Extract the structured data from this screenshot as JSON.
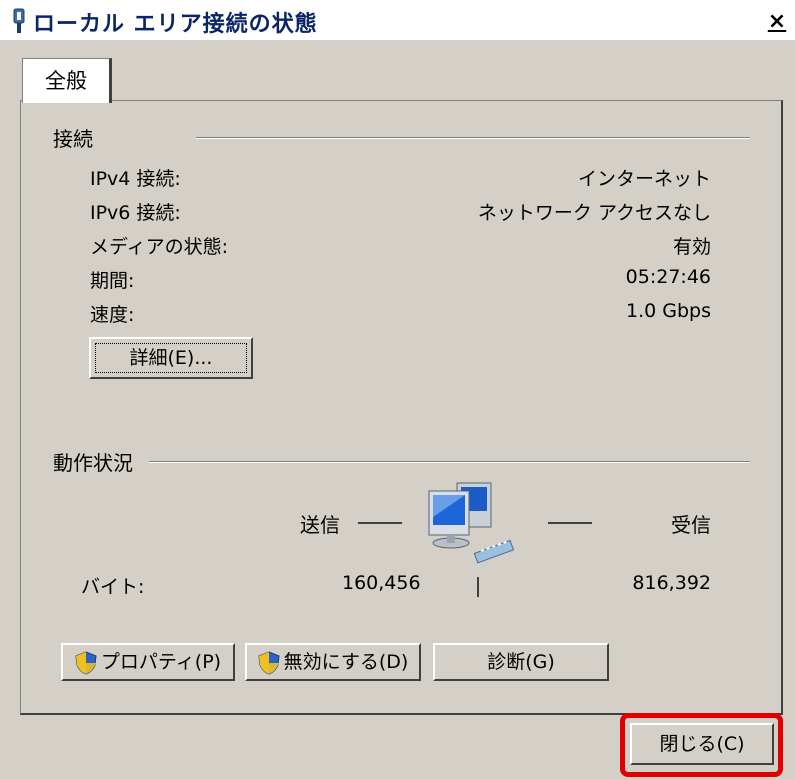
{
  "window": {
    "title": "ローカル エリア接続の状態",
    "close_label": "×"
  },
  "tabs": [
    {
      "label": "全般"
    }
  ],
  "connection": {
    "group_label": "接続",
    "rows": [
      {
        "label": "IPv4 接続:",
        "value": "インターネット"
      },
      {
        "label": "IPv6 接続:",
        "value": "ネットワーク アクセスなし"
      },
      {
        "label": "メディアの状態:",
        "value": "有効"
      },
      {
        "label": "期間:",
        "value": "05:27:46"
      },
      {
        "label": "速度:",
        "value": "1.0 Gbps"
      }
    ],
    "details_button": "詳細(E)..."
  },
  "activity": {
    "group_label": "動作状況",
    "sent_label": "送信",
    "received_label": "受信",
    "bytes_label": "バイト:",
    "bytes_sent": "160,456",
    "bytes_received": "816,392",
    "icon": "network-computers-icon"
  },
  "buttons": {
    "properties": "プロパティ(P)",
    "disable": "無効にする(D)",
    "diagnose": "診断(G)",
    "close": "閉じる(C)"
  },
  "colors": {
    "dialog_bg": "#d4d0c8",
    "title_text": "#0a246a",
    "highlight_border": "#e00000"
  }
}
